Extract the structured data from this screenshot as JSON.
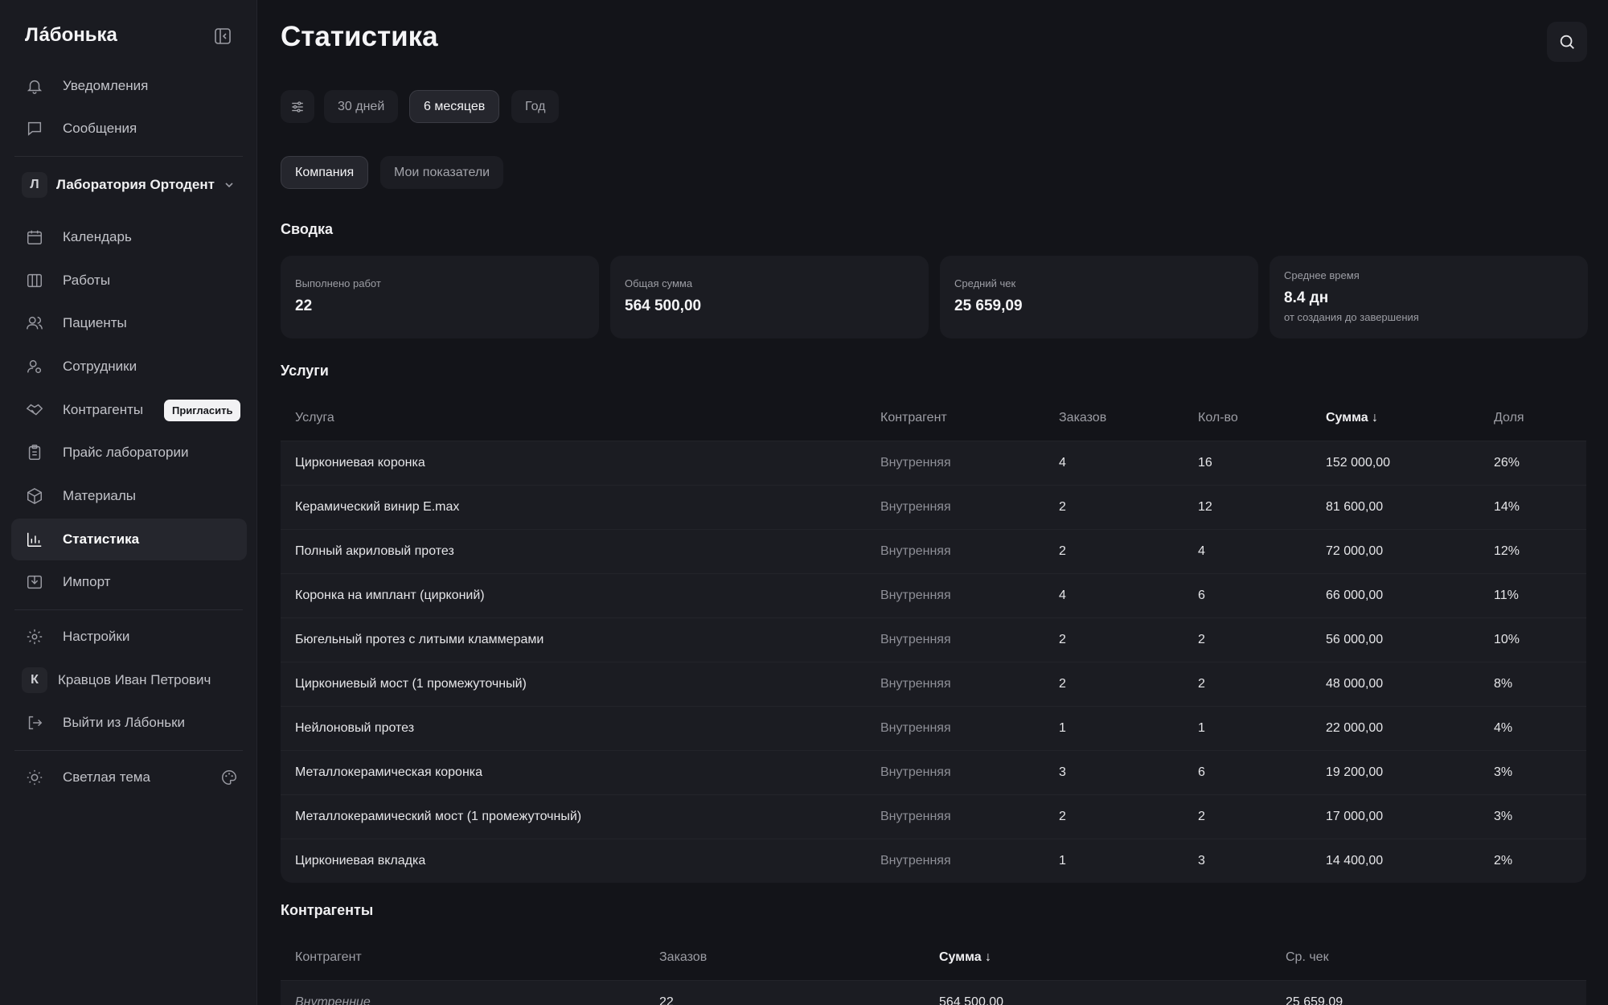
{
  "app": {
    "brand": "Ла́бонька"
  },
  "sidebar": {
    "top_items": [
      {
        "label": "Уведомления",
        "icon": "bell-icon"
      },
      {
        "label": "Сообщения",
        "icon": "message-icon"
      }
    ],
    "org": {
      "avatar": "Л",
      "name": "Лаборатория Ортодент"
    },
    "items": [
      {
        "label": "Календарь",
        "icon": "calendar-icon"
      },
      {
        "label": "Работы",
        "icon": "columns-icon"
      },
      {
        "label": "Пациенты",
        "icon": "users-icon"
      },
      {
        "label": "Сотрудники",
        "icon": "user-gear-icon"
      },
      {
        "label": "Контрагенты",
        "icon": "handshake-icon"
      },
      {
        "label": "Прайс лаборатории",
        "icon": "clipboard-icon"
      },
      {
        "label": "Материалы",
        "icon": "box-icon"
      },
      {
        "label": "Статистика",
        "icon": "bar-chart-icon"
      },
      {
        "label": "Импорт",
        "icon": "import-icon"
      }
    ],
    "invite_label": "Пригласить",
    "bottom_items": [
      {
        "label": "Настройки",
        "icon": "gear-icon"
      },
      {
        "label": "Кравцов Иван Петрович",
        "avatar": "К"
      },
      {
        "label": "Выйти из Ла́боньки",
        "icon": "logout-icon"
      }
    ],
    "theme_label": "Светлая тема"
  },
  "main": {
    "title": "Статистика",
    "periods": [
      "30 дней",
      "6 месяцев",
      "Год"
    ],
    "selected_period": "6 месяцев",
    "scopes": [
      "Компания",
      "Мои показатели"
    ],
    "selected_scope": "Компания",
    "summary_title": "Сводка",
    "cards": [
      {
        "label": "Выполнено работ",
        "value": "22"
      },
      {
        "label": "Общая сумма",
        "value": "564 500,00"
      },
      {
        "label": "Средний чек",
        "value": "25 659,09"
      },
      {
        "label": "Среднее время",
        "value": "8.4 дн",
        "sub": "от создания до завершения"
      }
    ],
    "services_title": "Услуги",
    "services_columns": [
      "Услуга",
      "Контрагент",
      "Заказов",
      "Кол-во",
      "Сумма ↓",
      "Доля"
    ],
    "services_rows": [
      [
        "Циркониевая коронка",
        "Внутренняя",
        "4",
        "16",
        "152 000,00",
        "26%"
      ],
      [
        "Керамический винир E.max",
        "Внутренняя",
        "2",
        "12",
        "81 600,00",
        "14%"
      ],
      [
        "Полный акриловый протез",
        "Внутренняя",
        "2",
        "4",
        "72 000,00",
        "12%"
      ],
      [
        "Коронка на имплант (цирконий)",
        "Внутренняя",
        "4",
        "6",
        "66 000,00",
        "11%"
      ],
      [
        "Бюгельный протез с литыми кламмерами",
        "Внутренняя",
        "2",
        "2",
        "56 000,00",
        "10%"
      ],
      [
        "Циркониевый мост (1 промежуточный)",
        "Внутренняя",
        "2",
        "2",
        "48 000,00",
        "8%"
      ],
      [
        "Нейлоновый протез",
        "Внутренняя",
        "1",
        "1",
        "22 000,00",
        "4%"
      ],
      [
        "Металлокерамическая коронка",
        "Внутренняя",
        "3",
        "6",
        "19 200,00",
        "3%"
      ],
      [
        "Металлокерамический мост (1 промежуточный)",
        "Внутренняя",
        "2",
        "2",
        "17 000,00",
        "3%"
      ],
      [
        "Циркониевая вкладка",
        "Внутренняя",
        "1",
        "3",
        "14 400,00",
        "2%"
      ]
    ],
    "contractors_title": "Контрагенты",
    "contractors_columns": [
      "Контрагент",
      "Заказов",
      "Сумма ↓",
      "Ср. чек"
    ],
    "contractors_rows": [
      [
        "Внутренние",
        "22",
        "564 500,00",
        "25 659,09"
      ]
    ]
  }
}
